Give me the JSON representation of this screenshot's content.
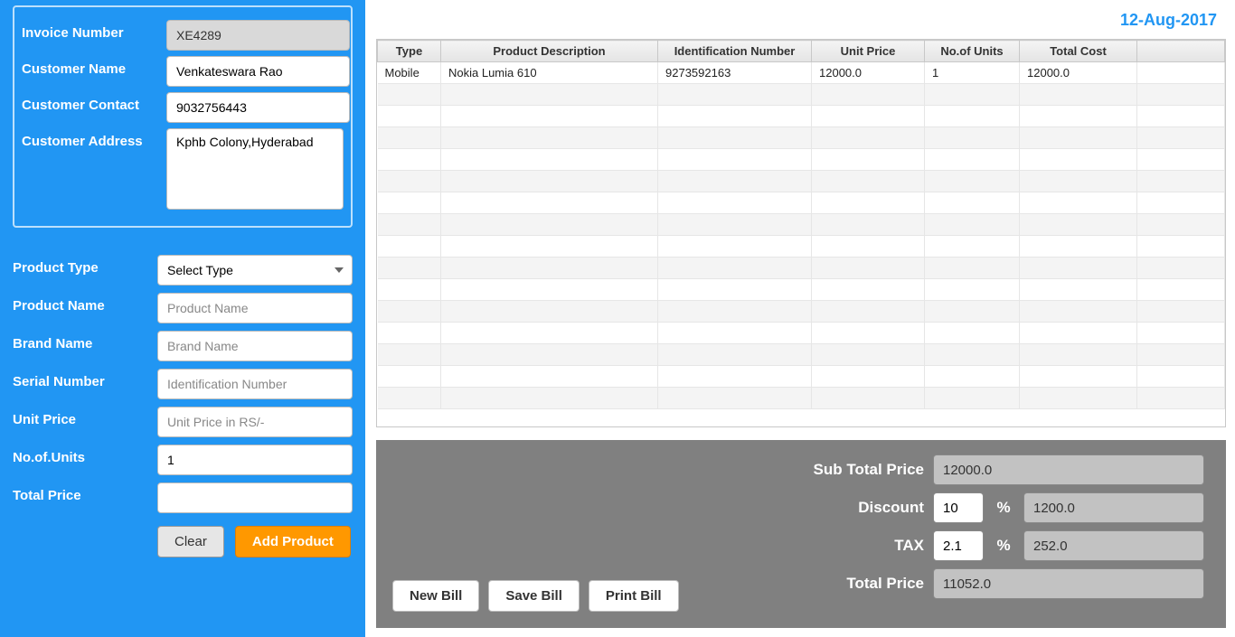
{
  "date": "12-Aug-2017",
  "customer": {
    "labels": {
      "invoice": "Invoice Number",
      "name": "Customer Name",
      "contact": "Customer Contact",
      "address": "Customer Address"
    },
    "invoice": "XE4289",
    "name": "Venkateswara Rao",
    "contact": "9032756443",
    "address": "Kphb Colony,Hyderabad"
  },
  "product": {
    "labels": {
      "type": "Product Type",
      "name": "Product Name",
      "brand": "Brand Name",
      "serial": "Serial Number",
      "unitprice": "Unit Price",
      "units": "No.of.Units",
      "total": "Total Price"
    },
    "type_selected": "Select Type",
    "name_ph": "Product Name",
    "brand_ph": "Brand Name",
    "serial_ph": "Identification Number",
    "unitprice_ph": "Unit Price in RS/-",
    "units_value": "1",
    "total_value": ""
  },
  "buttons": {
    "clear": "Clear",
    "add": "Add Product",
    "newbill": "New Bill",
    "savebill": "Save Bill",
    "printbill": "Print Bill"
  },
  "table": {
    "headers": {
      "type": "Type",
      "desc": "Product Description",
      "idnum": "Identification Number",
      "unitprice": "Unit Price",
      "units": "No.of Units",
      "total": "Total Cost"
    },
    "rows": [
      {
        "type": "Mobile",
        "desc": "Nokia Lumia 610",
        "idnum": "9273592163",
        "unitprice": "12000.0",
        "units": "1",
        "total": "12000.0"
      }
    ]
  },
  "totals": {
    "labels": {
      "subtotal": "Sub Total Price",
      "discount": "Discount",
      "tax": "TAX",
      "total": "Total Price",
      "pct": "%"
    },
    "subtotal": "12000.0",
    "discount_pct": "10",
    "discount_amt": "1200.0",
    "tax_pct": "2.1",
    "tax_amt": "252.0",
    "total": "11052.0"
  }
}
